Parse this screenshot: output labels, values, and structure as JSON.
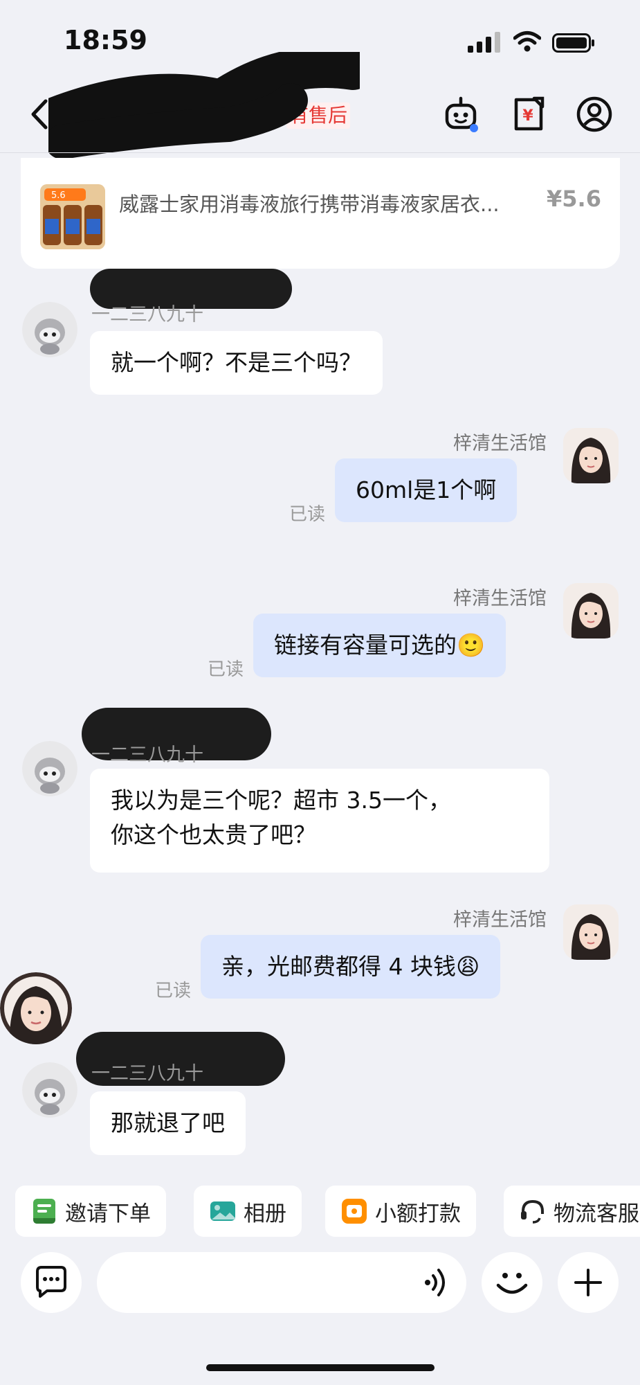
{
  "status_bar": {
    "time": "18:59"
  },
  "header": {
    "after_sale_tag": "有售后"
  },
  "product": {
    "title": "威露士家用消毒液旅行携带消毒液家居衣...",
    "price": "¥5.6",
    "thumb_badge": "5.6"
  },
  "messages": [
    {
      "side": "in",
      "nickname": "一二三八九十",
      "text": "就一个啊？不是三个吗？"
    },
    {
      "side": "out",
      "sender": "梓清生活馆",
      "text": "60ml是1个啊",
      "read": "已读"
    },
    {
      "side": "out",
      "sender": "梓清生活馆",
      "text": "链接有容量可选的🙂",
      "read": "已读"
    },
    {
      "side": "in",
      "nickname": "一二三八九十",
      "text_line1": "我以为是三个呢？超市 3.5一个，",
      "text_line2": "你这个也太贵了吧？"
    },
    {
      "side": "out",
      "sender": "梓清生活馆",
      "text": "亲，光邮费都得 4 块钱😩",
      "read": "已读"
    },
    {
      "side": "in",
      "nickname": "一二三八九十",
      "text": "那就退了吧"
    }
  ],
  "quick_actions": [
    {
      "label": "邀请下单",
      "icon": "invite-order-icon",
      "color": "#4caf50"
    },
    {
      "label": "相册",
      "icon": "album-icon",
      "color": "#26a69a"
    },
    {
      "label": "小额打款",
      "icon": "transfer-icon",
      "color": "#ff8f00"
    },
    {
      "label": "物流客服",
      "icon": "logistics-service-icon",
      "color": "#222222"
    }
  ],
  "input": {
    "placeholder": ""
  }
}
